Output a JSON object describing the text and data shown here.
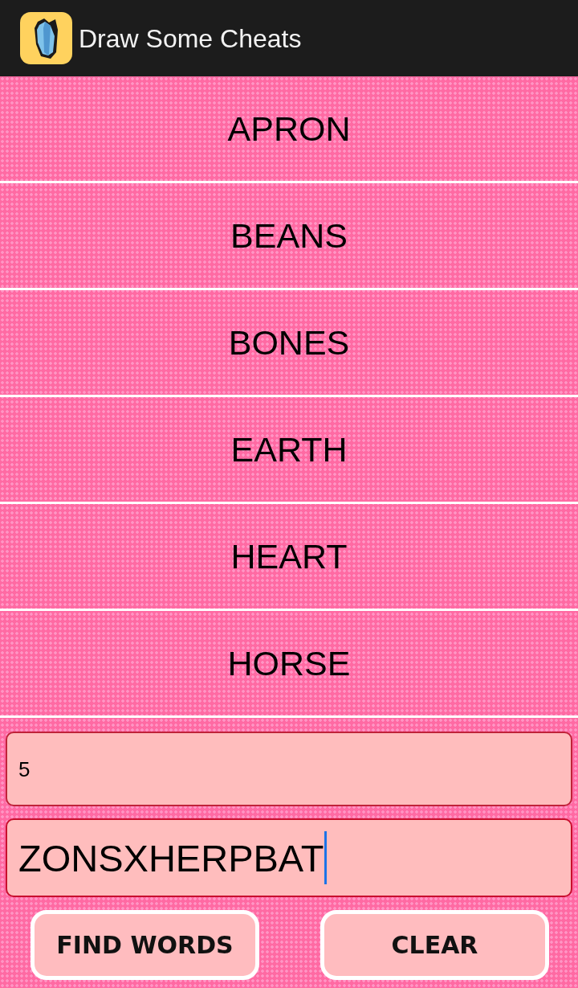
{
  "app_bar": {
    "title": "Draw Some Cheats"
  },
  "words": [
    "APRON",
    "BEANS",
    "BONES",
    "EARTH",
    "HEART",
    "HORSE"
  ],
  "fields": [
    {
      "value": "5",
      "focused": false
    },
    {
      "value": "ZONSXHERPBAT",
      "focused": true
    }
  ],
  "buttons": [
    "FIND WORDS",
    "CLEAR"
  ]
}
